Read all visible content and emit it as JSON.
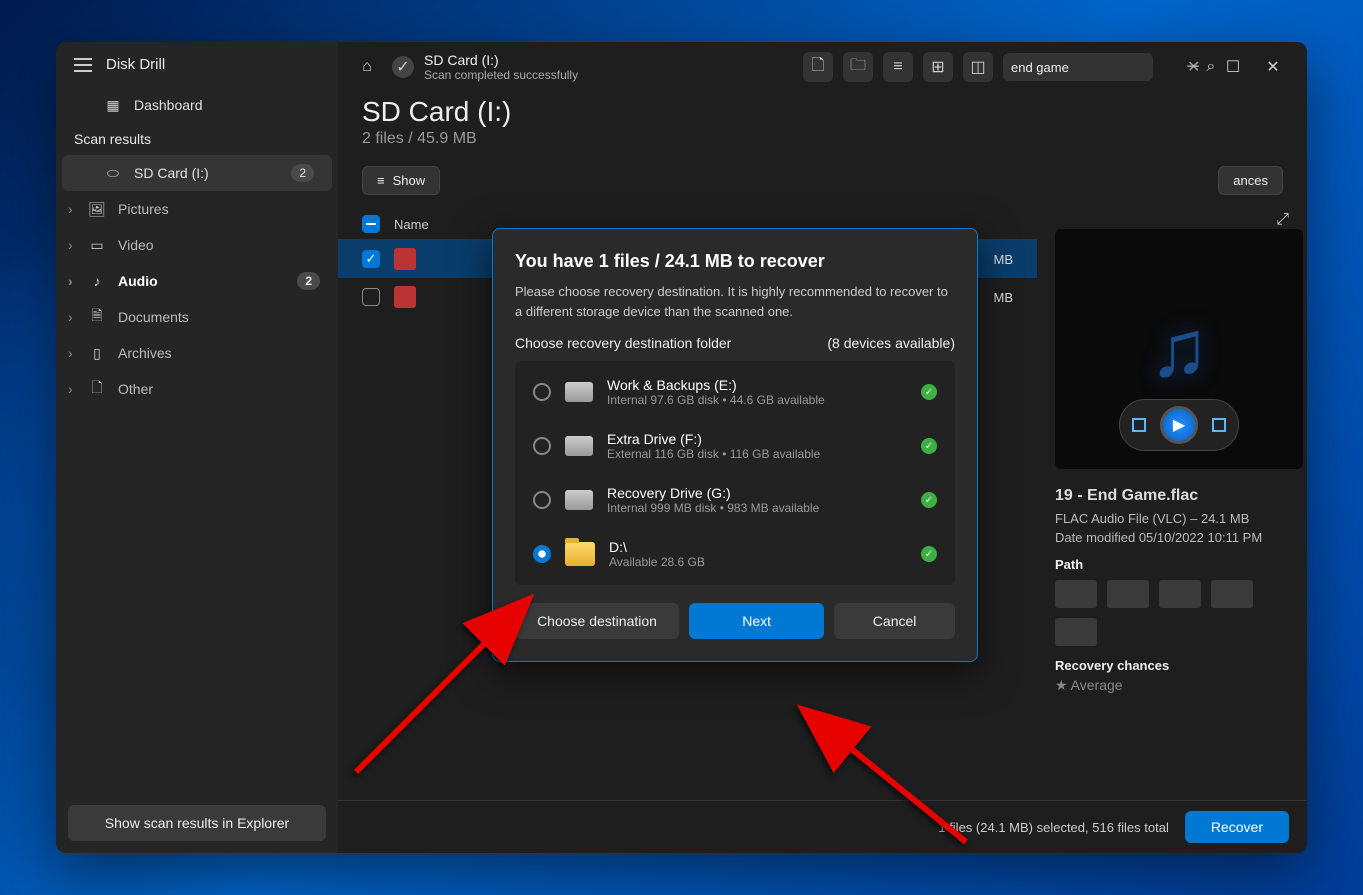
{
  "app": {
    "name": "Disk Drill"
  },
  "sidebar": {
    "dashboard": "Dashboard",
    "section": "Scan results",
    "items": [
      {
        "label": "SD Card (I:)",
        "badge": "2"
      },
      {
        "label": "Pictures"
      },
      {
        "label": "Video"
      },
      {
        "label": "Audio",
        "badge": "2"
      },
      {
        "label": "Documents"
      },
      {
        "label": "Archives"
      },
      {
        "label": "Other"
      }
    ],
    "footer_btn": "Show scan results in Explorer"
  },
  "topbar": {
    "crumb": "SD Card (I:)",
    "status": "Scan completed successfully",
    "search_value": "end game"
  },
  "title": {
    "main": "SD Card (I:)",
    "sub": "2 files / 45.9 MB"
  },
  "filters": {
    "show": "Show",
    "chances": "ances"
  },
  "table": {
    "header_name": "Name",
    "rows": [
      {
        "size": "MB"
      },
      {
        "size": "MB"
      }
    ]
  },
  "details": {
    "name": "19 - End Game.flac",
    "type": "FLAC Audio File (VLC) – 24.1 MB",
    "modified": "Date modified 05/10/2022 10:11 PM",
    "path_label": "Path",
    "chances_label": "Recovery chances",
    "chances_value": "Average"
  },
  "footer": {
    "stat": "1 files (24.1 MB) selected, 516 files total",
    "recover": "Recover"
  },
  "modal": {
    "title": "You have 1 files / 24.1 MB to recover",
    "desc": "Please choose recovery destination. It is highly recommended to recover to a different storage device than the scanned one.",
    "choose": "Choose recovery destination folder",
    "avail": "(8 devices available)",
    "dests": [
      {
        "name": "Work & Backups (E:)",
        "sub": "Internal 97.6 GB disk • 44.6 GB available",
        "type": "drive"
      },
      {
        "name": "Extra Drive (F:)",
        "sub": "External 116 GB disk • 116 GB available",
        "type": "drive"
      },
      {
        "name": "Recovery Drive (G:)",
        "sub": "Internal 999 MB disk • 983 MB available",
        "type": "drive"
      },
      {
        "name": "D:\\",
        "sub": "Available 28.6 GB",
        "type": "folder",
        "selected": true
      }
    ],
    "choose_btn": "Choose destination",
    "next": "Next",
    "cancel": "Cancel"
  }
}
